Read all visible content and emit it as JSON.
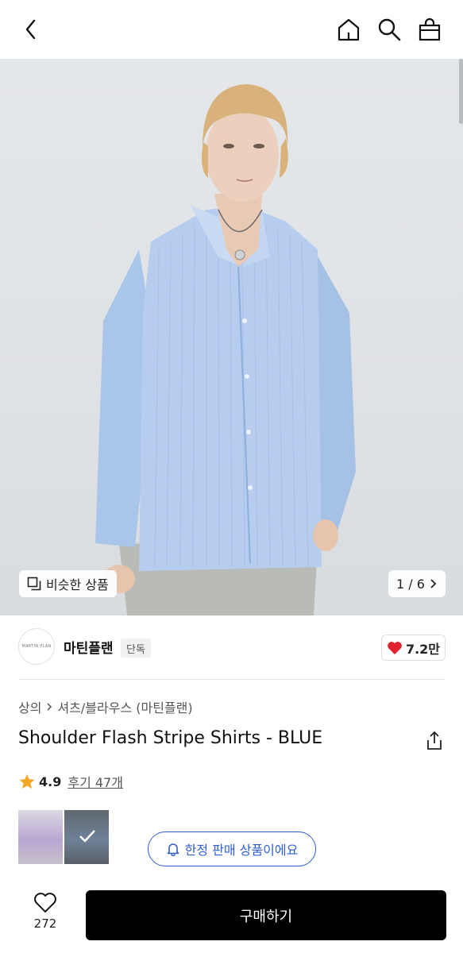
{
  "header": {
    "back_icon": "chevron-left-icon",
    "home_icon": "home-icon",
    "search_icon": "search-icon",
    "bag_icon": "shopping-bag-icon"
  },
  "gallery": {
    "similar_label": "비슷한 상품",
    "page_indicator": "1 / 6"
  },
  "brand": {
    "logo_text": "MARTIN PLAN",
    "name": "마틴플랜",
    "tag": "단독",
    "likes": "7.2만",
    "heart_color": "#e0232f"
  },
  "breadcrumb": {
    "category": "상의",
    "subcategory": "셔츠/블라우스 (마틴플랜)"
  },
  "product": {
    "title": "Shoulder Flash Stripe Shirts - BLUE"
  },
  "rating": {
    "value": "4.9",
    "reviews": "후기 47개",
    "star_color": "#f5a623"
  },
  "options": {
    "limited_label": "한정 판매 상품이에요",
    "accent_color": "#2f5fcf"
  },
  "bottom": {
    "wish_count": "272",
    "buy_label": "구매하기"
  }
}
